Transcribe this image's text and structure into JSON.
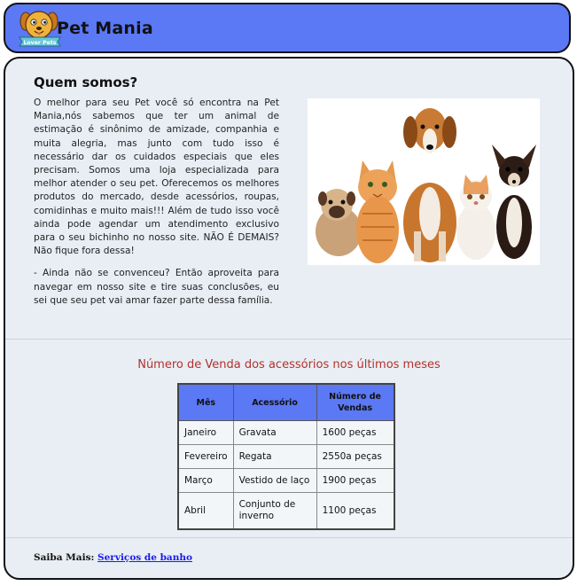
{
  "header": {
    "logo_text": "Lover Pets",
    "brand": "Pet Mania"
  },
  "about": {
    "title": "Quem somos?",
    "paragraph1": "O melhor para seu Pet você só encontra na Pet Mania,nós sabemos que ter um animal de estimação é sinônimo de amizade, companhia e muita alegria, mas junto com tudo isso é necessário dar os cuidados especiais que eles precisam. Somos uma loja especializada para melhor atender o seu pet. Oferecemos os melhores produtos do mercado, desde acessórios, roupas, comidinhas e muito mais!!! Além de tudo isso você ainda pode agendar um atendimento exclusivo para o seu bichinho no nosso site. NÃO É DEMAIS? Não fique fora dessa!",
    "paragraph2": "- Ainda não se convenceu? Então aproveita para navegar em nosso site e tire suas conclusões, eu sei que seu pet vai amar fazer parte dessa família."
  },
  "sales": {
    "title": "Número de Venda dos acessórios nos últimos meses",
    "headers": [
      "Mês",
      "Acessório",
      "Número de Vendas"
    ],
    "rows": [
      [
        "Janeiro",
        "Gravata",
        "1600 peças"
      ],
      [
        "Fevereiro",
        "Regata",
        "2550a peças"
      ],
      [
        "Março",
        "Vestido de laço",
        "1900 peças"
      ],
      [
        "Abril",
        "Conjunto de inverno",
        "1100 peças"
      ]
    ]
  },
  "footer": {
    "label": "Saiba Mais:",
    "link": "Serviços de banho"
  },
  "colors": {
    "header_bg": "#5b78f5",
    "main_bg": "#e8eef4",
    "title_red": "#b3312c",
    "link_blue": "#1a1aee"
  }
}
